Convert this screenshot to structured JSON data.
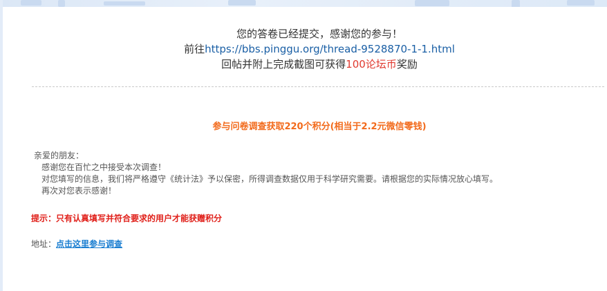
{
  "submission": {
    "line1": "您的答卷已经提交，感谢您的参与！",
    "line2_prefix": "前往",
    "line2_link": "https://bbs.pinggu.org/thread-9528870-1-1.html",
    "line3_prefix": "回帖并附上完成截图可获得",
    "line3_reward": "100论坛币",
    "line3_suffix": "奖励"
  },
  "points_title": "参与问卷调查获取220个积分(相当于2.2元微信零钱)",
  "letter": {
    "greeting": "亲爱的朋友：",
    "lines": [
      "感谢您在百忙之中接受本次调查！",
      "对您填写的信息，我们将严格遵守《统计法》予以保密，所得调查数据仅用于科学研究需要。请根据您的实际情况放心填写。",
      "再次对您表示感谢！"
    ]
  },
  "hint": "提示：只有认真填写并符合要求的用户才能获赠积分",
  "address": {
    "label": "地址：",
    "link_text": "点击这里参与调查"
  },
  "colors": {
    "link_blue": "#1a5fa5",
    "reward_red": "#e03a2f",
    "points_orange": "#f26a1b",
    "hint_red": "#e0201a",
    "address_link": "#1a7ed1"
  }
}
